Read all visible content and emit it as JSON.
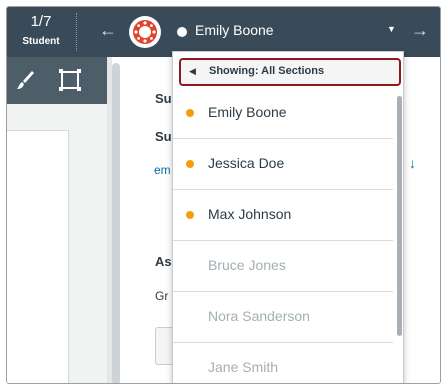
{
  "topbar": {
    "counter": "1/7",
    "counter_label": "Student",
    "prev_arrow": "←",
    "next_arrow": "→",
    "student_name": "Emily Boone",
    "caret": "▼",
    "avatar_icon": "canvas-logo-icon"
  },
  "toolbar": {
    "icons": [
      "paintbrush-icon",
      "select-region-icon"
    ]
  },
  "panel": {
    "line1": "Su",
    "line2": "Su",
    "link": "em",
    "line3": "As",
    "line4": "Gr",
    "download_icon": "↓"
  },
  "dropdown": {
    "header": "Showing: All Sections",
    "header_icon": "◀",
    "students": [
      {
        "name": "Emily Boone",
        "active": true
      },
      {
        "name": "Jessica Doe",
        "active": true
      },
      {
        "name": "Max Johnson",
        "active": true
      },
      {
        "name": "Bruce Jones",
        "active": false
      },
      {
        "name": "Nora Sanderson",
        "active": false
      },
      {
        "name": "Jane Smith",
        "active": false
      }
    ]
  },
  "colors": {
    "topbar_bg": "#394b58",
    "toolbar_bg": "#4d5e69",
    "submission_dot": "#f39c12",
    "highlight_border": "#8b1a1a",
    "link": "#0770a3"
  }
}
